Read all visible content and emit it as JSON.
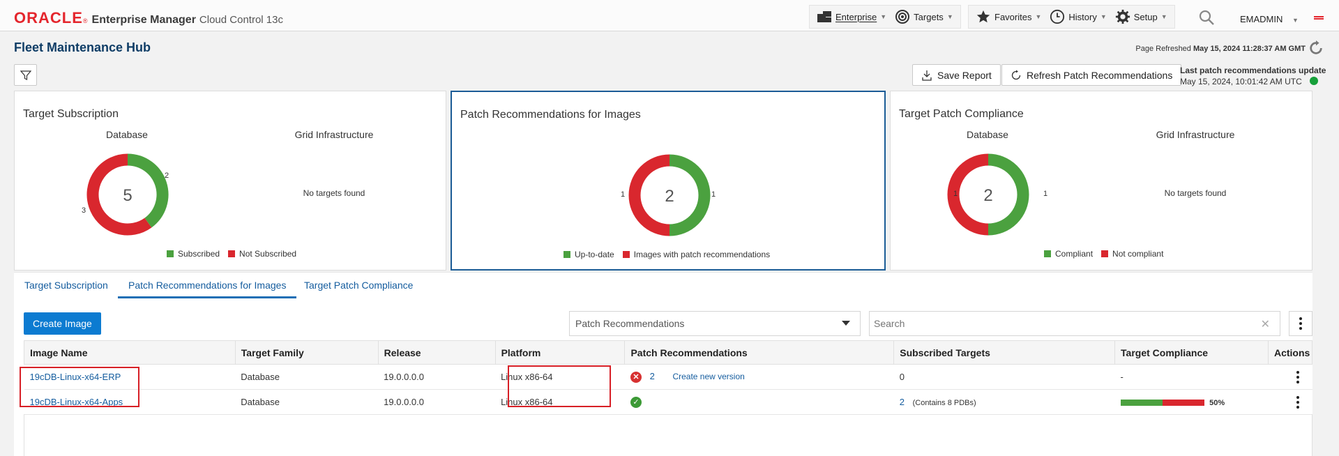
{
  "header": {
    "brand": "ORACLE",
    "reg": "®",
    "product": "Enterprise Manager",
    "product_suffix": "Cloud Control 13c",
    "menu_left": [
      {
        "label": "Enterprise",
        "icon": "enterprise-icon"
      },
      {
        "label": "Targets",
        "icon": "targets-icon"
      }
    ],
    "menu_right": [
      {
        "label": "Favorites",
        "icon": "star-icon"
      },
      {
        "label": "History",
        "icon": "clock-icon"
      },
      {
        "label": "Setup",
        "icon": "gear-icon"
      }
    ],
    "user": "EMADMIN"
  },
  "page": {
    "title": "Fleet Maintenance Hub",
    "refreshed_label": "Page Refreshed",
    "refreshed_value": "May 15, 2024 11:28:37 AM GMT"
  },
  "toolbar": {
    "save_report": "Save Report",
    "refresh_recs": "Refresh Patch Recommendations",
    "last_update_title": "Last patch recommendations update",
    "last_update_value": "May 15, 2024, 10:01:42 AM UTC"
  },
  "cards": {
    "subscription": {
      "title": "Target Subscription",
      "database": {
        "label": "Database",
        "total": "5",
        "subscribed": 2,
        "not_subscribed": 3,
        "subscribed_label": "2",
        "not_subscribed_label": "3"
      },
      "grid": {
        "label": "Grid Infrastructure",
        "empty": "No targets found"
      },
      "legend": [
        "Subscribed",
        "Not Subscribed"
      ]
    },
    "images": {
      "title": "Patch Recommendations for Images",
      "total": "2",
      "up_to_date": 1,
      "with_recs": 1,
      "up_to_date_label": "1",
      "with_recs_label": "1",
      "legend": [
        "Up-to-date",
        "Images with patch recommendations"
      ]
    },
    "compliance": {
      "title": "Target Patch Compliance",
      "database": {
        "label": "Database",
        "total": "2",
        "compliant": 1,
        "not_compliant": 1,
        "compliant_label": "1",
        "not_compliant_label": "1"
      },
      "grid": {
        "label": "Grid Infrastructure",
        "empty": "No targets found"
      },
      "legend": [
        "Compliant",
        "Not compliant"
      ]
    }
  },
  "colors": {
    "green": "#4ba13f",
    "red": "#d9272e",
    "accent": "#1b5c96"
  },
  "tabs": [
    "Target Subscription",
    "Patch Recommendations for Images",
    "Target Patch Compliance"
  ],
  "panel": {
    "create_image": "Create Image",
    "filter_select": "Patch Recommendations",
    "search_placeholder": "Search"
  },
  "table": {
    "columns": [
      "Image Name",
      "Target Family",
      "Release",
      "Platform",
      "Patch Recommendations",
      "Subscribed Targets",
      "Target Compliance",
      "Actions"
    ],
    "rows": [
      {
        "name": "19cDB-Linux-x64-ERP",
        "family": "Database",
        "release": "19.0.0.0.0",
        "platform": "Linux x86-64",
        "recs_count": "2",
        "recs_action": "Create new version",
        "subscribed": "0",
        "subscribed_note": "",
        "compliance": "-"
      },
      {
        "name": "19cDB-Linux-x64-Apps",
        "family": "Database",
        "release": "19.0.0.0.0",
        "platform": "Linux x86-64",
        "recs_count": "",
        "recs_action": "",
        "subscribed": "2",
        "subscribed_note": "(Contains 8 PDBs)",
        "compliance": "50%",
        "compliance_value": 0.5
      }
    ]
  }
}
